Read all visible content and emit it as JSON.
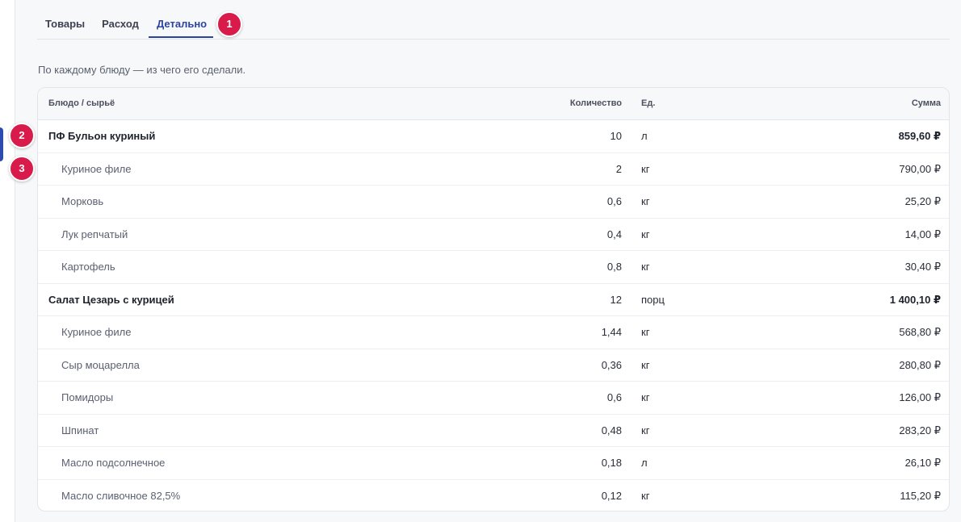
{
  "tabs": [
    {
      "label": "Товары"
    },
    {
      "label": "Расход"
    },
    {
      "label": "Детально"
    }
  ],
  "badges": [
    "1",
    "2",
    "3"
  ],
  "subtitle": "По каждому блюду — из чего его сделали.",
  "table": {
    "headers": {
      "name": "Блюдо / сырьё",
      "qty": "Количество",
      "unit": "Ед.",
      "sum": "Сумма"
    },
    "rows": [
      {
        "name": "ПФ Бульон куриный",
        "qty": "10",
        "unit": "л",
        "sum": "859,60 ₽"
      },
      {
        "name": "Куриное филе",
        "qty": "2",
        "unit": "кг",
        "sum": "790,00 ₽"
      },
      {
        "name": "Морковь",
        "qty": "0,6",
        "unit": "кг",
        "sum": "25,20 ₽"
      },
      {
        "name": "Лук репчатый",
        "qty": "0,4",
        "unit": "кг",
        "sum": "14,00 ₽"
      },
      {
        "name": "Картофель",
        "qty": "0,8",
        "unit": "кг",
        "sum": "30,40 ₽"
      },
      {
        "name": "Салат Цезарь с курицей",
        "qty": "12",
        "unit": "порц",
        "sum": "1 400,10 ₽"
      },
      {
        "name": "Куриное филе",
        "qty": "1,44",
        "unit": "кг",
        "sum": "568,80 ₽"
      },
      {
        "name": "Сыр моцарелла",
        "qty": "0,36",
        "unit": "кг",
        "sum": "280,80 ₽"
      },
      {
        "name": "Помидоры",
        "qty": "0,6",
        "unit": "кг",
        "sum": "126,00 ₽"
      },
      {
        "name": "Шпинат",
        "qty": "0,48",
        "unit": "кг",
        "sum": "283,20 ₽"
      },
      {
        "name": "Масло подсолнечное",
        "qty": "0,18",
        "unit": "л",
        "sum": "26,10 ₽"
      },
      {
        "name": "Масло сливочное 82,5%",
        "qty": "0,12",
        "unit": "кг",
        "sum": "115,20 ₽"
      }
    ]
  },
  "colors": {
    "accent": "#2b44a0",
    "badge": "#d81b4a"
  }
}
